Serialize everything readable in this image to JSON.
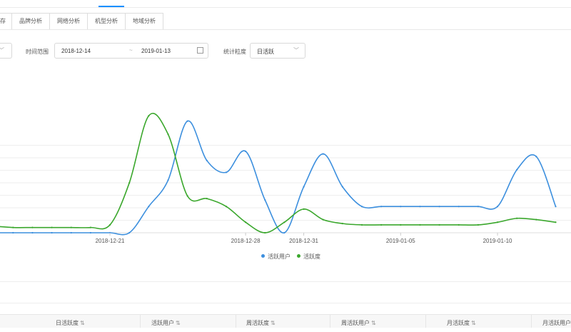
{
  "colors": {
    "blue": "#3c8fde",
    "green": "#3aa72c",
    "accent": "#1890ff",
    "grid": "#eeeeee"
  },
  "tabs": [
    "存",
    "品牌分析",
    "网络分析",
    "机型分析",
    "地域分析"
  ],
  "filters": {
    "time_label": "时间范围",
    "start_date": "2018-12-14",
    "range_sep": "~",
    "end_date": "2019-01-13",
    "gran_label": "统计粒度",
    "gran_value": "日活跃"
  },
  "chart_data": {
    "type": "line",
    "x_labels": [
      "2018-12-21",
      "2018-12-28",
      "2018-12-31",
      "2019-01-05",
      "2019-01-10"
    ],
    "x": [
      "2018-12-14",
      "2018-12-15",
      "2018-12-16",
      "2018-12-17",
      "2018-12-18",
      "2018-12-19",
      "2018-12-20",
      "2018-12-21",
      "2018-12-22",
      "2018-12-23",
      "2018-12-24",
      "2018-12-25",
      "2018-12-26",
      "2018-12-27",
      "2018-12-28",
      "2018-12-29",
      "2018-12-30",
      "2018-12-31",
      "2019-01-01",
      "2019-01-02",
      "2019-01-03",
      "2019-01-04",
      "2019-01-05",
      "2019-01-06",
      "2019-01-07",
      "2019-01-08",
      "2019-01-09",
      "2019-01-10",
      "2019-01-11",
      "2019-01-12",
      "2019-01-13"
    ],
    "series": [
      {
        "name": "活跃用户",
        "color": "#3c8fde",
        "values": [
          0,
          0,
          0,
          0,
          0,
          0,
          0,
          0,
          0,
          20,
          40,
          85,
          55,
          46,
          62,
          25,
          0,
          35,
          60,
          35,
          20,
          20,
          20,
          20,
          20,
          20,
          20,
          20,
          48,
          58,
          20
        ]
      },
      {
        "name": "活跃度",
        "color": "#3aa72c",
        "values": [
          6,
          5,
          4,
          4,
          4,
          4,
          4,
          6,
          38,
          89,
          75,
          28,
          26,
          20,
          8,
          0,
          8,
          18,
          10,
          7,
          6,
          6,
          6,
          6,
          6,
          6,
          6,
          8,
          11,
          10,
          8
        ]
      }
    ],
    "ylim": [
      0,
      100
    ],
    "grid": true,
    "legend": "bottom-center"
  },
  "table": {
    "headers": [
      "日活跃度",
      "活跃用户",
      "周活跃度",
      "周活跃用户",
      "月活跃度",
      "月活跃用户"
    ],
    "sort_icon": "⇅"
  }
}
